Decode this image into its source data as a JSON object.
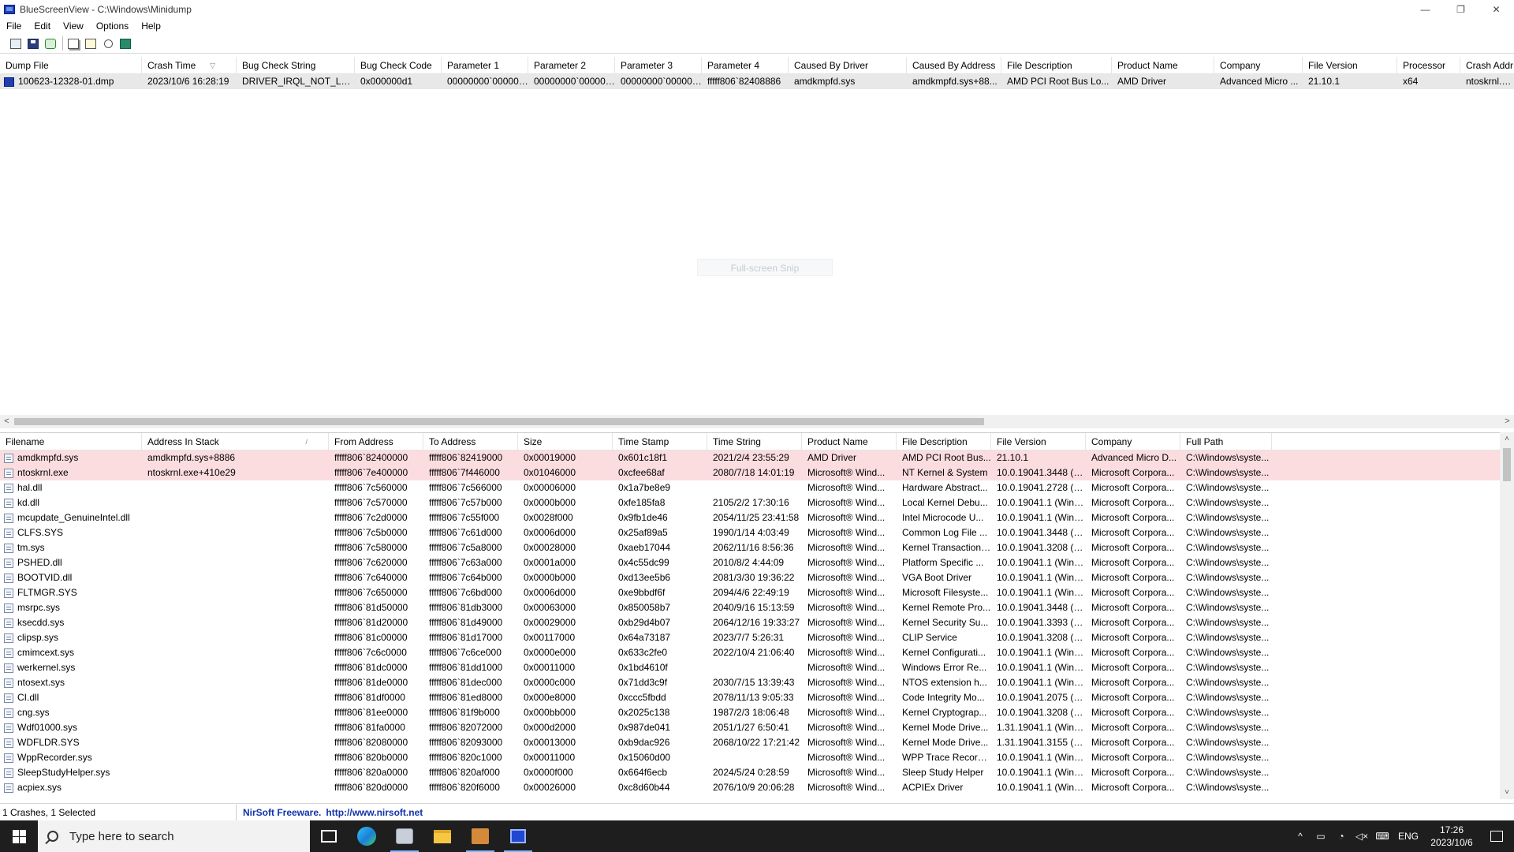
{
  "window": {
    "title": "BlueScreenView  -  C:\\Windows\\Minidump",
    "minimize": "—",
    "maximize": "❐",
    "close": "✕"
  },
  "menu": [
    "File",
    "Edit",
    "View",
    "Options",
    "Help"
  ],
  "toolbar": [
    "html-report-icon",
    "save-icon",
    "refresh-icon",
    "copy-icon",
    "properties-icon",
    "find-icon",
    "exit-icon"
  ],
  "crashes": {
    "columns": [
      "Dump File",
      "Crash Time",
      "Bug Check String",
      "Bug Check Code",
      "Parameter 1",
      "Parameter 2",
      "Parameter 3",
      "Parameter 4",
      "Caused By Driver",
      "Caused By Address",
      "File Description",
      "Product Name",
      "Company",
      "File Version",
      "Processor",
      "Crash Addr"
    ],
    "sort_indicator": "▽",
    "rows": [
      [
        "100623-12328-01.dmp",
        "2023/10/6 16:28:19",
        "DRIVER_IRQL_NOT_LESS...",
        "0x000000d1",
        "00000000`000000...",
        "00000000`000000...",
        "00000000`000000...",
        "fffff806`82408886",
        "amdkmpfd.sys",
        "amdkmpfd.sys+88...",
        "AMD PCI Root Bus Lo...",
        "AMD Driver",
        "Advanced Micro ...",
        "21.10.1",
        "x64",
        "ntoskrnl.exe"
      ]
    ]
  },
  "snip_hint": "Full-screen Snip",
  "drivers": {
    "columns": [
      "Filename",
      "Address In Stack",
      "From Address",
      "To Address",
      "Size",
      "Time Stamp",
      "Time String",
      "Product Name",
      "File Description",
      "File Version",
      "Company",
      "Full Path"
    ],
    "sort_indicator": "/",
    "rows": [
      [
        "amdkmpfd.sys",
        "amdkmpfd.sys+8886",
        "fffff806`82400000",
        "fffff806`82419000",
        "0x00019000",
        "0x601c18f1",
        "2021/2/4 23:55:29",
        "AMD Driver",
        "AMD PCI Root Bus...",
        "21.10.1",
        "Advanced Micro D...",
        "C:\\Windows\\syste..."
      ],
      [
        "ntoskrnl.exe",
        "ntoskrnl.exe+410e29",
        "fffff806`7e400000",
        "fffff806`7f446000",
        "0x01046000",
        "0xcfee68af",
        "2080/7/18 14:01:19",
        "Microsoft® Wind...",
        "NT Kernel & System",
        "10.0.19041.3448 (W...",
        "Microsoft Corpora...",
        "C:\\Windows\\syste..."
      ],
      [
        "hal.dll",
        "",
        "fffff806`7c560000",
        "fffff806`7c566000",
        "0x00006000",
        "0x1a7be8e9",
        "",
        "Microsoft® Wind...",
        "Hardware Abstract...",
        "10.0.19041.2728 (W...",
        "Microsoft Corpora...",
        "C:\\Windows\\syste..."
      ],
      [
        "kd.dll",
        "",
        "fffff806`7c570000",
        "fffff806`7c57b000",
        "0x0000b000",
        "0xfe185fa8",
        "2105/2/2 17:30:16",
        "Microsoft® Wind...",
        "Local Kernel Debu...",
        "10.0.19041.1 (WinB...",
        "Microsoft Corpora...",
        "C:\\Windows\\syste..."
      ],
      [
        "mcupdate_GenuineIntel.dll",
        "",
        "fffff806`7c2d0000",
        "fffff806`7c55f000",
        "0x0028f000",
        "0x9fb1de46",
        "2054/11/25 23:41:58",
        "Microsoft® Wind...",
        "Intel Microcode U...",
        "10.0.19041.1 (WinB...",
        "Microsoft Corpora...",
        "C:\\Windows\\syste..."
      ],
      [
        "CLFS.SYS",
        "",
        "fffff806`7c5b0000",
        "fffff806`7c61d000",
        "0x0006d000",
        "0x25af89a5",
        "1990/1/14 4:03:49",
        "Microsoft® Wind...",
        "Common Log File ...",
        "10.0.19041.3448 (W...",
        "Microsoft Corpora...",
        "C:\\Windows\\syste..."
      ],
      [
        "tm.sys",
        "",
        "fffff806`7c580000",
        "fffff806`7c5a8000",
        "0x00028000",
        "0xaeb17044",
        "2062/11/16 8:56:36",
        "Microsoft® Wind...",
        "Kernel Transaction ...",
        "10.0.19041.3208 (W...",
        "Microsoft Corpora...",
        "C:\\Windows\\syste..."
      ],
      [
        "PSHED.dll",
        "",
        "fffff806`7c620000",
        "fffff806`7c63a000",
        "0x0001a000",
        "0x4c55dc99",
        "2010/8/2 4:44:09",
        "Microsoft® Wind...",
        "Platform Specific ...",
        "10.0.19041.1 (WinB...",
        "Microsoft Corpora...",
        "C:\\Windows\\syste..."
      ],
      [
        "BOOTVID.dll",
        "",
        "fffff806`7c640000",
        "fffff806`7c64b000",
        "0x0000b000",
        "0xd13ee5b6",
        "2081/3/30 19:36:22",
        "Microsoft® Wind...",
        "VGA Boot Driver",
        "10.0.19041.1 (WinB...",
        "Microsoft Corpora...",
        "C:\\Windows\\syste..."
      ],
      [
        "FLTMGR.SYS",
        "",
        "fffff806`7c650000",
        "fffff806`7c6bd000",
        "0x0006d000",
        "0xe9bbdf6f",
        "2094/4/6 22:49:19",
        "Microsoft® Wind...",
        "Microsoft Filesyste...",
        "10.0.19041.1 (WinB...",
        "Microsoft Corpora...",
        "C:\\Windows\\syste..."
      ],
      [
        "msrpc.sys",
        "",
        "fffff806`81d50000",
        "fffff806`81db3000",
        "0x00063000",
        "0x850058b7",
        "2040/9/16 15:13:59",
        "Microsoft® Wind...",
        "Kernel Remote Pro...",
        "10.0.19041.3448 (W...",
        "Microsoft Corpora...",
        "C:\\Windows\\syste..."
      ],
      [
        "ksecdd.sys",
        "",
        "fffff806`81d20000",
        "fffff806`81d49000",
        "0x00029000",
        "0xb29d4b07",
        "2064/12/16 19:33:27",
        "Microsoft® Wind...",
        "Kernel Security Su...",
        "10.0.19041.3393 (W...",
        "Microsoft Corpora...",
        "C:\\Windows\\syste..."
      ],
      [
        "clipsp.sys",
        "",
        "fffff806`81c00000",
        "fffff806`81d17000",
        "0x00117000",
        "0x64a73187",
        "2023/7/7 5:26:31",
        "Microsoft® Wind...",
        "CLIP Service",
        "10.0.19041.3208 (W...",
        "Microsoft Corpora...",
        "C:\\Windows\\syste..."
      ],
      [
        "cmimcext.sys",
        "",
        "fffff806`7c6c0000",
        "fffff806`7c6ce000",
        "0x0000e000",
        "0x633c2fe0",
        "2022/10/4 21:06:40",
        "Microsoft® Wind...",
        "Kernel Configurati...",
        "10.0.19041.1 (WinB...",
        "Microsoft Corpora...",
        "C:\\Windows\\syste..."
      ],
      [
        "werkernel.sys",
        "",
        "fffff806`81dc0000",
        "fffff806`81dd1000",
        "0x00011000",
        "0x1bd4610f",
        "",
        "Microsoft® Wind...",
        "Windows Error Re...",
        "10.0.19041.1 (WinB...",
        "Microsoft Corpora...",
        "C:\\Windows\\syste..."
      ],
      [
        "ntosext.sys",
        "",
        "fffff806`81de0000",
        "fffff806`81dec000",
        "0x0000c000",
        "0x71dd3c9f",
        "2030/7/15 13:39:43",
        "Microsoft® Wind...",
        "NTOS extension h...",
        "10.0.19041.1 (WinB...",
        "Microsoft Corpora...",
        "C:\\Windows\\syste..."
      ],
      [
        "CI.dll",
        "",
        "fffff806`81df0000",
        "fffff806`81ed8000",
        "0x000e8000",
        "0xccc5fbdd",
        "2078/11/13 9:05:33",
        "Microsoft® Wind...",
        "Code Integrity Mo...",
        "10.0.19041.2075 (W...",
        "Microsoft Corpora...",
        "C:\\Windows\\syste..."
      ],
      [
        "cng.sys",
        "",
        "fffff806`81ee0000",
        "fffff806`81f9b000",
        "0x000bb000",
        "0x2025c138",
        "1987/2/3 18:06:48",
        "Microsoft® Wind...",
        "Kernel Cryptograp...",
        "10.0.19041.3208 (W...",
        "Microsoft Corpora...",
        "C:\\Windows\\syste..."
      ],
      [
        "Wdf01000.sys",
        "",
        "fffff806`81fa0000",
        "fffff806`82072000",
        "0x000d2000",
        "0x987de041",
        "2051/1/27 6:50:41",
        "Microsoft® Wind...",
        "Kernel Mode Drive...",
        "1.31.19041.1 (WinB...",
        "Microsoft Corpora...",
        "C:\\Windows\\syste..."
      ],
      [
        "WDFLDR.SYS",
        "",
        "fffff806`82080000",
        "fffff806`82093000",
        "0x00013000",
        "0xb9dac926",
        "2068/10/22 17:21:42",
        "Microsoft® Wind...",
        "Kernel Mode Drive...",
        "1.31.19041.3155 (W...",
        "Microsoft Corpora...",
        "C:\\Windows\\syste..."
      ],
      [
        "WppRecorder.sys",
        "",
        "fffff806`820b0000",
        "fffff806`820c1000",
        "0x00011000",
        "0x15060d00",
        "",
        "Microsoft® Wind...",
        "WPP Trace Recorder",
        "10.0.19041.1 (WinB...",
        "Microsoft Corpora...",
        "C:\\Windows\\syste..."
      ],
      [
        "SleepStudyHelper.sys",
        "",
        "fffff806`820a0000",
        "fffff806`820af000",
        "0x0000f000",
        "0x664f6ecb",
        "2024/5/24 0:28:59",
        "Microsoft® Wind...",
        "Sleep Study Helper",
        "10.0.19041.1 (WinB...",
        "Microsoft Corpora...",
        "C:\\Windows\\syste..."
      ],
      [
        "acpiex.sys",
        "",
        "fffff806`820d0000",
        "fffff806`820f6000",
        "0x00026000",
        "0xc8d60b44",
        "2076/10/9 20:06:28",
        "Microsoft® Wind...",
        "ACPIEx Driver",
        "10.0.19041.1 (WinB...",
        "Microsoft Corpora...",
        "C:\\Windows\\syste..."
      ]
    ]
  },
  "status": {
    "left": "1 Crashes, 1 Selected",
    "brand": "NirSoft Freeware.",
    "link": "http://www.nirsoft.net"
  },
  "taskbar": {
    "search_placeholder": "Type here to search",
    "tray_up": "^",
    "lang": "ENG",
    "time": "17:26",
    "date": "2023/10/6"
  },
  "colors": {
    "highlight_row": "#fbdde0",
    "selected_row": "#e8e8e8",
    "link": "#1133aa",
    "taskbar": "#1e1e1e"
  }
}
